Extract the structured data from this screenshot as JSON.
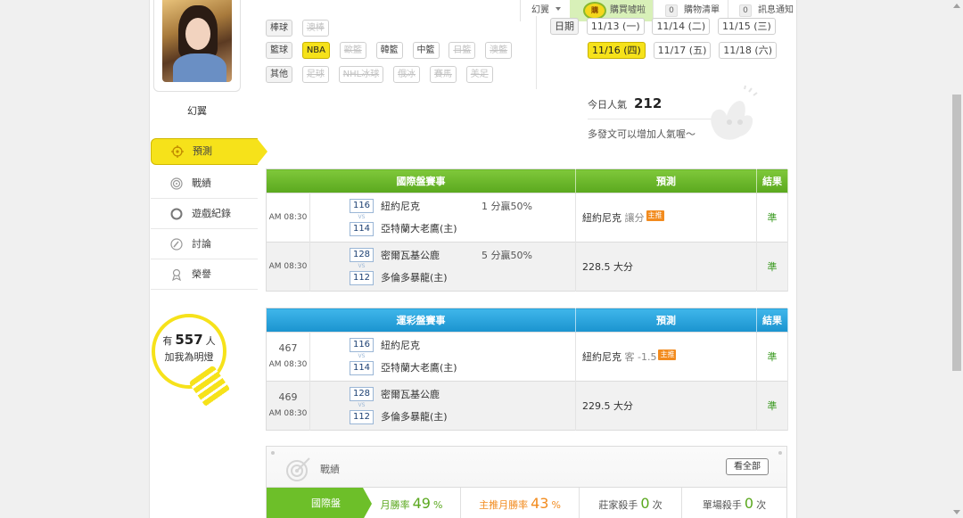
{
  "topbar": {
    "user": "幻翼",
    "buy_logo": "購",
    "buy_label": "購買噓啦",
    "cart_count": "0",
    "cart_label": "購物清單",
    "notice_count": "0",
    "notice_label": "訊息通知"
  },
  "profile": {
    "name": "幻翼",
    "fans_prefix": "有",
    "fans_count": "557",
    "fans_suffix": "人",
    "fans_line2": "加我為明燈"
  },
  "menu": [
    {
      "label": "預測",
      "icon": "crosshair-icon"
    },
    {
      "label": "戰績",
      "icon": "target-icon"
    },
    {
      "label": "遊戲紀錄",
      "icon": "record-icon"
    },
    {
      "label": "討論",
      "icon": "discussion-icon"
    },
    {
      "label": "榮譽",
      "icon": "medal-icon"
    }
  ],
  "filters": {
    "baseball": {
      "label": "棒球",
      "items": [
        "澳棒"
      ]
    },
    "basketball": {
      "label": "籃球",
      "items": [
        "NBA",
        "歐籃",
        "韓籃",
        "中籃",
        "日籃",
        "澳籃"
      ]
    },
    "other": {
      "label": "其他",
      "items": [
        "足球",
        "NHL冰球",
        "俄冰",
        "賽馬",
        "美足"
      ]
    }
  },
  "dates": {
    "label": "日期",
    "row1": [
      "11/13 (一)",
      "11/14 (二)",
      "11/15 (三)"
    ],
    "row2": [
      "11/16 (四)",
      "11/17 (五)",
      "11/18 (六)"
    ]
  },
  "popularity": {
    "label": "今日人氣",
    "value": "212",
    "tip": "多發文可以增加人氣喔～"
  },
  "international": {
    "headers": [
      "國際盤賽事",
      "預測",
      "結果"
    ],
    "rows": [
      {
        "time": "AM 08:30",
        "score_top": "116",
        "score_bot": "114",
        "vs": "VS",
        "team_top": "紐約尼克",
        "team_bot": "亞特蘭大老鷹(主)",
        "spread": "1 分贏50%",
        "pred_main": "紐約尼克",
        "pred_sub": "讓分",
        "tag": "主推",
        "result": "準"
      },
      {
        "time": "AM 08:30",
        "score_top": "128",
        "score_bot": "112",
        "vs": "VS",
        "team_top": "密爾瓦基公鹿",
        "team_bot": "多倫多暴龍(主)",
        "spread": "5 分贏50%",
        "pred_main": "228.5 大分",
        "pred_sub": "",
        "tag": "",
        "result": "準"
      }
    ]
  },
  "lottery": {
    "headers": [
      "運彩盤賽事",
      "預測",
      "結果"
    ],
    "rows": [
      {
        "id": "467",
        "time": "AM 08:30",
        "score_top": "116",
        "score_bot": "114",
        "vs": "VS",
        "team_top": "紐約尼克",
        "team_bot": "亞特蘭大老鷹(主)",
        "pred_main": "紐約尼克",
        "pred_sub": "客 -1.5",
        "tag": "主推",
        "result": "準"
      },
      {
        "id": "469",
        "time": "AM 08:30",
        "score_top": "128",
        "score_bot": "112",
        "vs": "VS",
        "team_top": "密爾瓦基公鹿",
        "team_bot": "多倫多暴龍(主)",
        "pred_main": "229.5 大分",
        "pred_sub": "",
        "tag": "",
        "result": "準"
      }
    ]
  },
  "record": {
    "title": "戰績",
    "view_all": "看全部",
    "tab": "國際盤",
    "monthly_label": "月勝率",
    "monthly_value": "49",
    "monthly_unit": "%",
    "main_label": "主推月勝率",
    "main_value": "43",
    "main_unit": "%",
    "house_label": "莊家殺手",
    "house_value": "0",
    "house_unit": "次",
    "single_label": "單場殺手",
    "single_value": "0",
    "single_unit": "次"
  },
  "colors": {
    "accent_yellow": "#f6e21a",
    "green_header": "#5aa81e",
    "blue_header": "#1a93cf",
    "tag_orange": "#f28b1e"
  }
}
